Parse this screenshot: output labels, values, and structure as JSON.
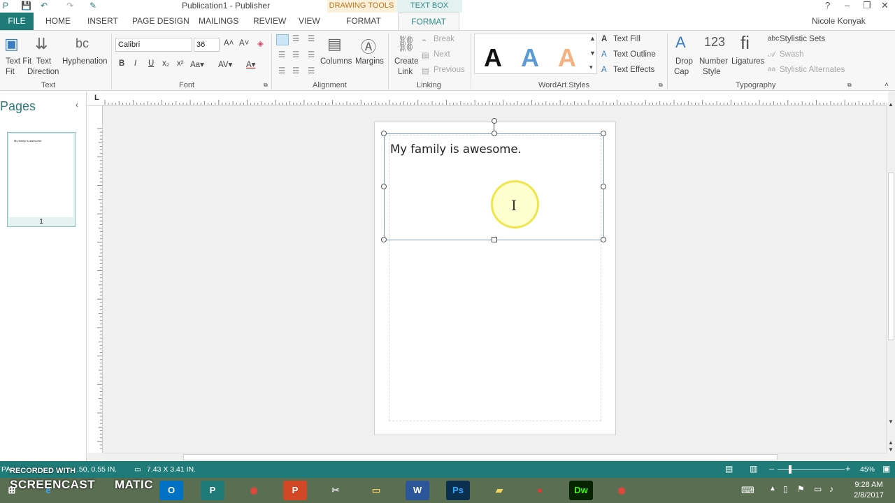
{
  "window": {
    "title": "Publication1 - Publisher",
    "context_drawing": "DRAWING TOOLS",
    "context_textbox": "TEXT BOX TOOLS",
    "user": "Nicole Konyak"
  },
  "tabs": {
    "file": "FILE",
    "home": "HOME",
    "insert": "INSERT",
    "page_design": "PAGE DESIGN",
    "mailings": "MAILINGS",
    "review": "REVIEW",
    "view": "VIEW",
    "format_drawing": "FORMAT",
    "format_textbox": "FORMAT"
  },
  "ribbon": {
    "text": {
      "group": "Text",
      "text_fit": "Text Fit",
      "text_fit_2": "Fit",
      "text_direction": "Text",
      "text_direction_2": "Direction",
      "hyphenation": "Hyphenation"
    },
    "font": {
      "group": "Font",
      "family": "Calibri",
      "size": "36"
    },
    "alignment": {
      "group": "Alignment",
      "columns": "Columns",
      "margins": "Margins"
    },
    "linking": {
      "group": "Linking",
      "create_link": "Create",
      "create_link_2": "Link",
      "break": "Break",
      "next": "Next",
      "previous": "Previous"
    },
    "wordart": {
      "group": "WordArt Styles",
      "text_fill": "Text Fill",
      "text_outline": "Text Outline",
      "text_effects": "Text Effects"
    },
    "typography": {
      "group": "Typography",
      "drop_cap": "Drop",
      "drop_cap_2": "Cap",
      "number_style": "Number",
      "number_style_2": "Style",
      "ligatures": "Ligatures",
      "stylistic_sets": "Stylistic Sets",
      "swash": "Swash",
      "stylistic_alternates": "Stylistic Alternates"
    }
  },
  "pages_panel": {
    "title": "Pages",
    "page_number": "1",
    "thumb_text": "My family is awesome."
  },
  "document": {
    "textbox_text": "My family is awesome."
  },
  "status": {
    "page_info": "PA...",
    "position": ".50, 0.55 IN.",
    "size": "7.43 X 3.41 IN.",
    "zoom": "45%"
  },
  "taskbar": {
    "watermark_top": "RECORDED WITH",
    "watermark_brand": "SCREENCAST",
    "watermark_brand_2": "MATIC",
    "time": "9:28 AM",
    "date": "2/8/2017"
  },
  "colors": {
    "accent": "#1f7b77",
    "context_drawing": "#c0731a",
    "context_textbox": "#2e8b8a"
  }
}
